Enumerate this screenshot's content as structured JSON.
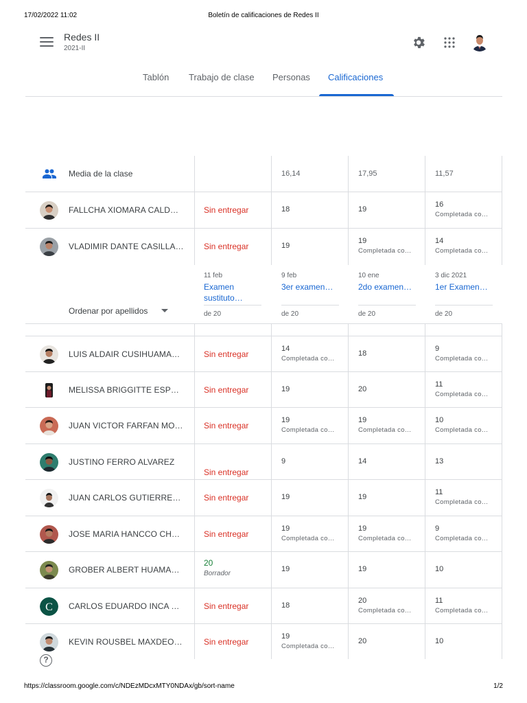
{
  "print_header": {
    "datetime": "17/02/2022 11:02",
    "title": "Boletín de calificaciones de Redes II"
  },
  "print_footer": {
    "url": "https://classroom.google.com/c/NDEzMDcxMTY0NDAx/gb/sort-name",
    "page": "1/2"
  },
  "appbar": {
    "course_name": "Redes II",
    "course_section": "2021-II",
    "icons": [
      "menu-icon",
      "gear-icon",
      "apps-icon",
      "account-avatar"
    ]
  },
  "tabs": [
    {
      "label": "Tablón"
    },
    {
      "label": "Trabajo de clase"
    },
    {
      "label": "Personas"
    },
    {
      "label": "Calificaciones",
      "active": true
    }
  ],
  "colors": {
    "accent": "#1967d2",
    "missing": "#d93025",
    "draft": "#188038",
    "divider": "#dadce0"
  },
  "class_average": {
    "label": "Media de la clase",
    "values": [
      "16,14",
      "17,95",
      "11,57"
    ]
  },
  "sort": {
    "label": "Ordenar por apellidos"
  },
  "assignments": [
    {
      "date": "11 feb",
      "title": "Examen sustituto…",
      "points": "de 20"
    },
    {
      "date": "9 feb",
      "title": "3er examen…",
      "points": "de 20"
    },
    {
      "date": "10 ene",
      "title": "2do examen…",
      "points": "de 20"
    },
    {
      "date": "3 dic 2021",
      "title": "1er Examen…",
      "points": "de 20"
    }
  ],
  "status_text": {
    "missing": "Sin entregar",
    "completed": "Completada co…",
    "draft": "Borrador"
  },
  "students": [
    {
      "name": "FALLCHA XIOMARA CALD…",
      "sub": {
        "status": "missing"
      },
      "g1": {
        "v": "18"
      },
      "g2": {
        "v": "19"
      },
      "g3": {
        "v": "16",
        "s": "Completada co…"
      }
    },
    {
      "name": "VLADIMIR DANTE CASILLA…",
      "sub": {
        "status": "missing"
      },
      "g1": {
        "v": "19"
      },
      "g2": {
        "v": "19",
        "s": "Completada co…"
      },
      "g3": {
        "v": "14",
        "s": "Completada co…"
      }
    },
    {
      "name": "LUIS ALDAIR CUSIHUAMA…",
      "sub": {
        "status": "missing"
      },
      "g1": {
        "v": "14",
        "s": "Completada co…"
      },
      "g2": {
        "v": "18"
      },
      "g3": {
        "v": "9",
        "s": "Completada co…"
      }
    },
    {
      "name": "MELISSA BRIGGITTE ESPE…",
      "sub": {
        "status": "missing"
      },
      "g1": {
        "v": "19"
      },
      "g2": {
        "v": "20"
      },
      "g3": {
        "v": "11",
        "s": "Completada co…"
      }
    },
    {
      "name": "JUAN VICTOR FARFAN MO…",
      "sub": {
        "status": "missing"
      },
      "g1": {
        "v": "19",
        "s": "Completada co…"
      },
      "g2": {
        "v": "19",
        "s": "Completada co…"
      },
      "g3": {
        "v": "10",
        "s": "Completada co…"
      }
    },
    {
      "name": "JUSTINO FERRO ALVAREZ",
      "sub": {
        "status": "missing"
      },
      "g1": {
        "v": "9"
      },
      "g2": {
        "v": "14"
      },
      "g3": {
        "v": "13"
      }
    },
    {
      "name": "JUAN CARLOS GUTIERREZ…",
      "sub": {
        "status": "missing"
      },
      "g1": {
        "v": "19"
      },
      "g2": {
        "v": "19"
      },
      "g3": {
        "v": "11",
        "s": "Completada co…"
      }
    },
    {
      "name": "JOSE MARIA HANCCO CH…",
      "sub": {
        "status": "missing"
      },
      "g1": {
        "v": "19",
        "s": "Completada co…"
      },
      "g2": {
        "v": "19",
        "s": "Completada co…"
      },
      "g3": {
        "v": "9",
        "s": "Completada co…"
      }
    },
    {
      "name": "GROBER ALBERT HUAMA…",
      "sub": {
        "status": "draft",
        "grade": "20"
      },
      "g1": {
        "v": "19"
      },
      "g2": {
        "v": "19"
      },
      "g3": {
        "v": "10"
      }
    },
    {
      "name": "CARLOS EDUARDO INCA …",
      "sub": {
        "status": "missing"
      },
      "g1": {
        "v": "18"
      },
      "g2": {
        "v": "20",
        "s": "Completada co…"
      },
      "g3": {
        "v": "11",
        "s": "Completada co…"
      }
    },
    {
      "name": "KEVIN ROUSBEL MAXDEO …",
      "sub": {
        "status": "missing"
      },
      "g1": {
        "v": "19",
        "s": "Completada co…"
      },
      "g2": {
        "v": "20"
      },
      "g3": {
        "v": "10"
      }
    }
  ],
  "avatar_letters": {
    "carlos": "C"
  }
}
